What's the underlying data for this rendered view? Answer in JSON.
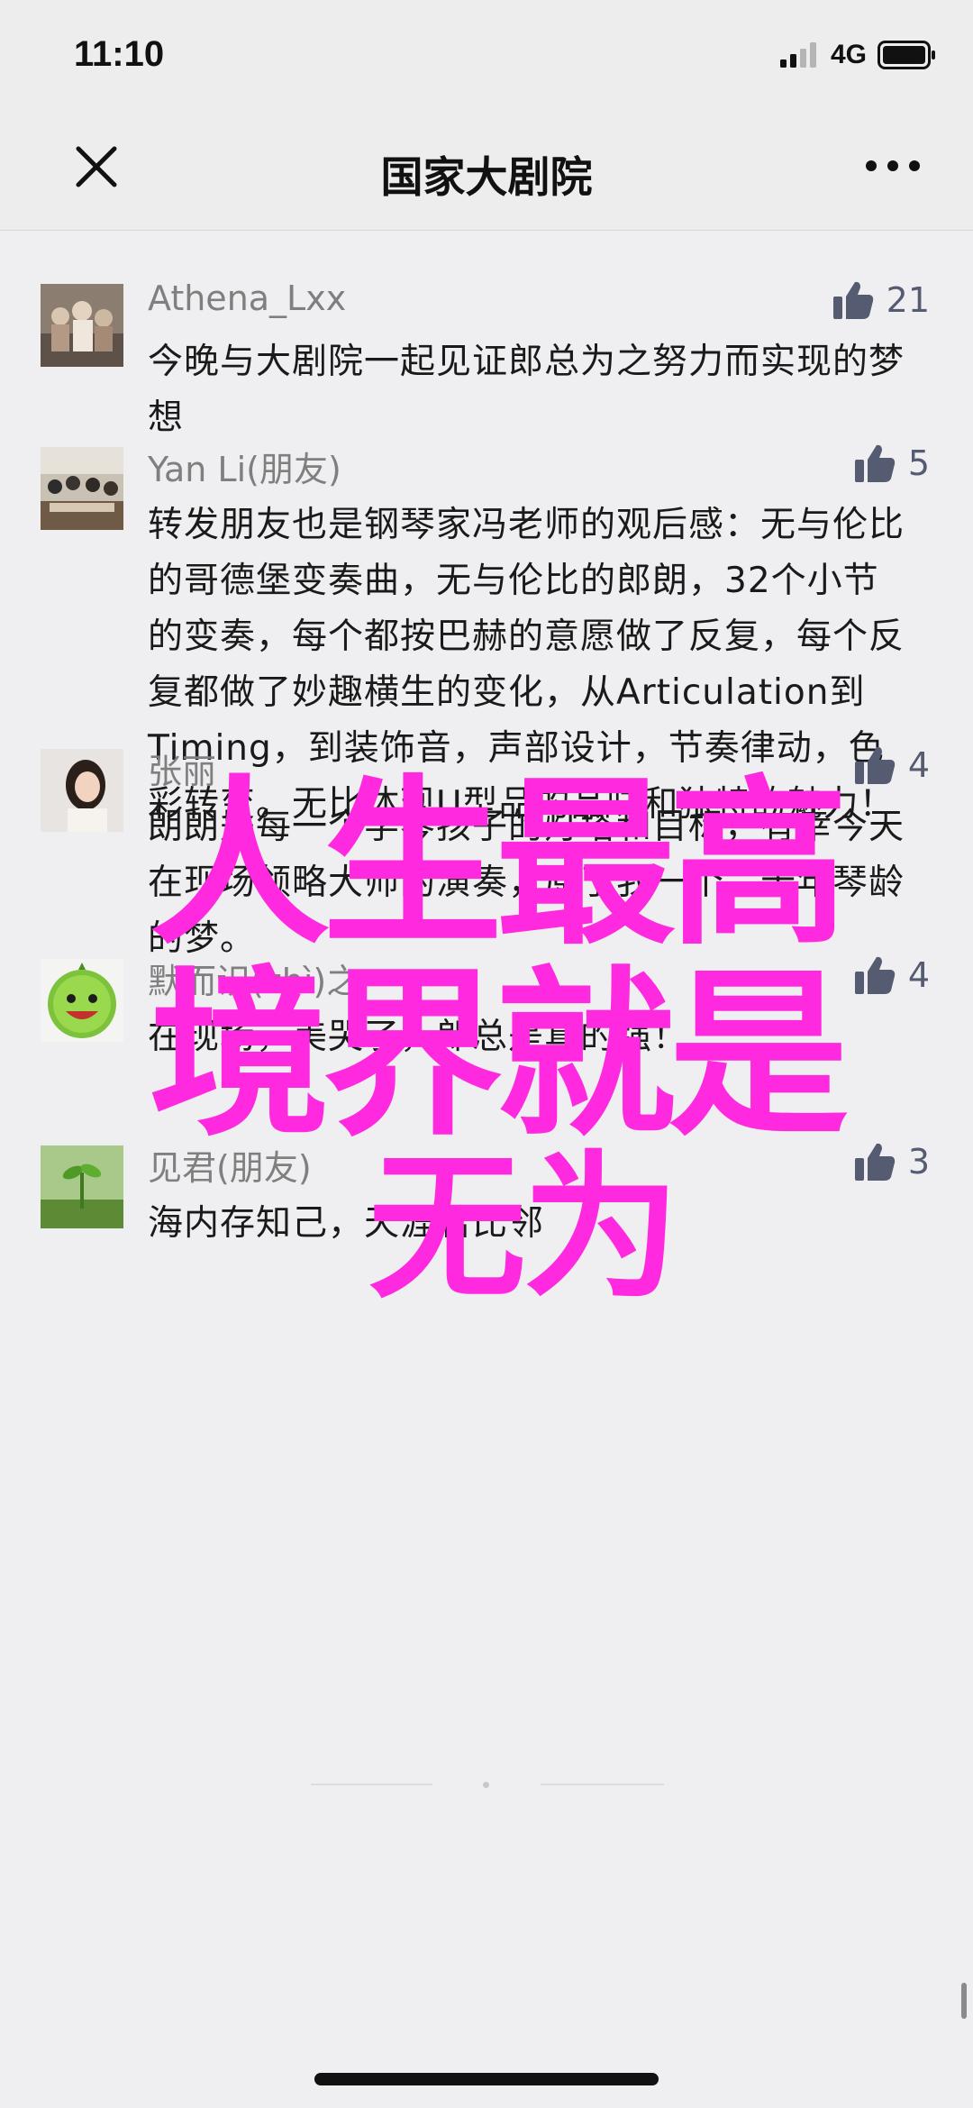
{
  "status_bar": {
    "time": "11:10",
    "network": "4G"
  },
  "nav": {
    "title": "国家大剧院",
    "close_icon": "close-icon",
    "more_icon": "more-icon"
  },
  "comments": [
    {
      "name": "Athena_Lxx",
      "likes": "21",
      "text": "今晚与大剧院一起见证郎总为之努力而实现的梦想"
    },
    {
      "name": "Yan Li(朋友)",
      "likes": "5",
      "text": "转发朋友也是钢琴家冯老师的观后感：无与伦比的哥德堡变奏曲，无与伦比的郎朗，32个小节的变奏，每个都按巴赫的意愿做了反复，每个反复都做了妙趣横生的变化，从Articulation到Timing，到装饰音，声部设计，节奏律动，色彩转变。无比体现U型品的品味和独特的魅力！"
    },
    {
      "name": "张丽",
      "likes": "4",
      "text": "朗朗是每一个学琴孩子的灯塔和目标，有幸今天在现场领略大师的演奏，原了我一个二十年琴龄的梦。"
    },
    {
      "name": "默而识(zhì)之",
      "likes": "4",
      "text": "在现场，美哭了，郎总是真的强！"
    },
    {
      "name": "见君(朋友)",
      "likes": "3",
      "text": "海内存知己，天涯若比邻"
    }
  ],
  "overlay": {
    "line1": "人生最高",
    "line2": "境界就是",
    "line3": "无为"
  },
  "colors": {
    "overlay": "#ff2ae0",
    "like": "#555c72",
    "background": "#efeff1"
  }
}
